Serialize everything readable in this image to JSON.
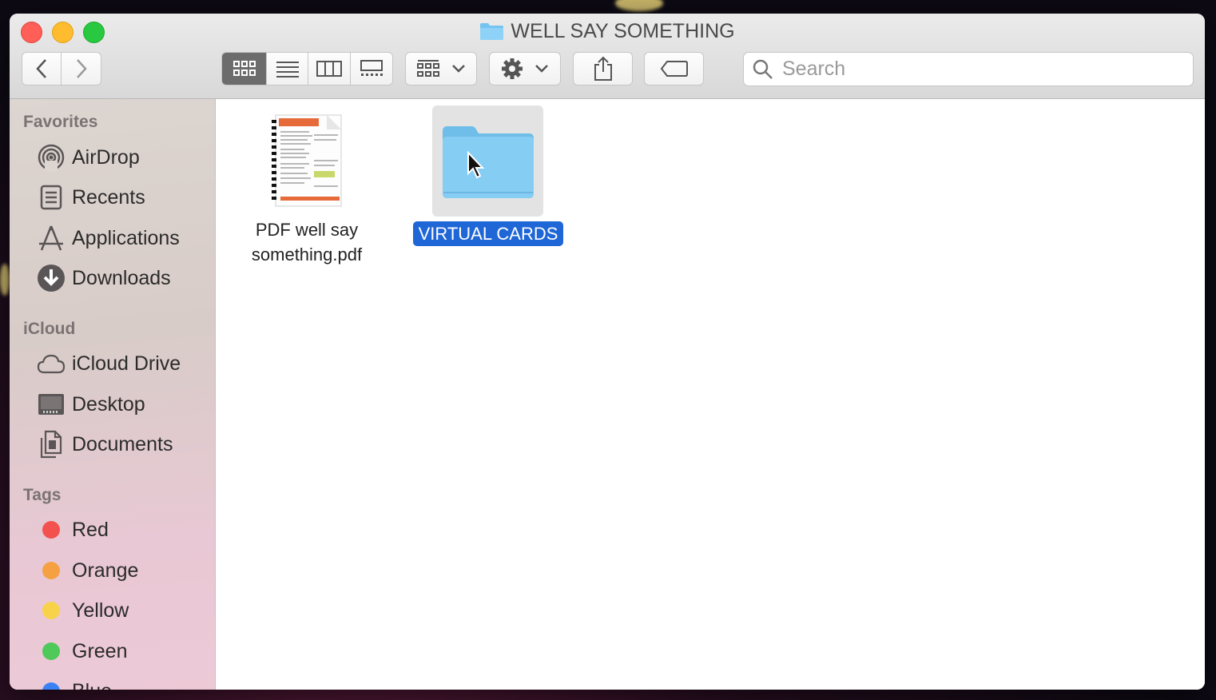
{
  "window": {
    "title": "WELL SAY SOMETHING"
  },
  "toolbar": {
    "back_label": "back",
    "forward_label": "forward",
    "search_placeholder": "Search"
  },
  "sidebar": {
    "favorites_header": "Favorites",
    "favorites": [
      {
        "label": "AirDrop",
        "icon": "airdrop-icon"
      },
      {
        "label": "Recents",
        "icon": "recents-icon"
      },
      {
        "label": "Applications",
        "icon": "applications-icon"
      },
      {
        "label": "Downloads",
        "icon": "downloads-icon"
      }
    ],
    "icloud_header": "iCloud",
    "icloud": [
      {
        "label": "iCloud Drive",
        "icon": "cloud-icon"
      },
      {
        "label": "Desktop",
        "icon": "desktop-icon"
      },
      {
        "label": "Documents",
        "icon": "documents-icon"
      }
    ],
    "tags_header": "Tags",
    "tags": [
      {
        "label": "Red",
        "color": "#f2514d"
      },
      {
        "label": "Orange",
        "color": "#f5a142"
      },
      {
        "label": "Yellow",
        "color": "#f8d34a"
      },
      {
        "label": "Green",
        "color": "#4fc95a"
      },
      {
        "label": "Blue",
        "color": "#3b82f6"
      }
    ]
  },
  "files": [
    {
      "name_line1": "PDF well say",
      "name_line2": "something.pdf",
      "kind": "pdf-file-icon",
      "selected": false
    },
    {
      "name": "VIRTUAL CARDS",
      "kind": "folder-icon",
      "selected": true
    }
  ],
  "colors": {
    "selection": "#1f66d6",
    "folder": "#7cc8f3"
  }
}
